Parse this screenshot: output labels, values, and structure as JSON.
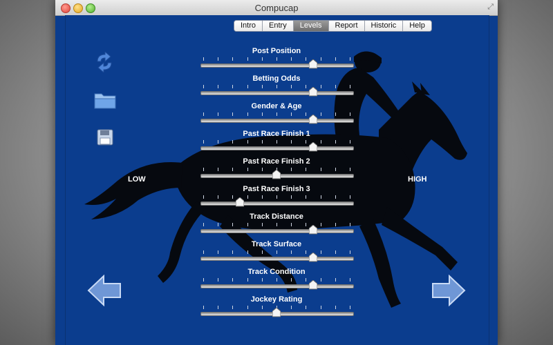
{
  "window": {
    "title": "Compucap"
  },
  "tabs": [
    {
      "label": "Intro",
      "active": false
    },
    {
      "label": "Entry",
      "active": false
    },
    {
      "label": "Levels",
      "active": true
    },
    {
      "label": "Report",
      "active": false
    },
    {
      "label": "Historic",
      "active": false
    },
    {
      "label": "Help",
      "active": false
    }
  ],
  "scale": {
    "low_label": "LOW",
    "high_label": "HIGH"
  },
  "sliders": [
    {
      "label": "Post Position",
      "value": 0.74
    },
    {
      "label": "Betting Odds",
      "value": 0.74
    },
    {
      "label": "Gender & Age",
      "value": 0.74
    },
    {
      "label": "Past Race Finish 1",
      "value": 0.74
    },
    {
      "label": "Past Race Finish 2",
      "value": 0.5
    },
    {
      "label": "Past Race Finish 3",
      "value": 0.26
    },
    {
      "label": "Track Distance",
      "value": 0.74
    },
    {
      "label": "Track Surface",
      "value": 0.74
    },
    {
      "label": "Track Condition",
      "value": 0.74
    },
    {
      "label": "Jockey Rating",
      "value": 0.5
    }
  ],
  "icons": {
    "refresh": "refresh-icon",
    "folder": "folder-icon",
    "save": "save-icon",
    "back": "arrow-left-icon",
    "forward": "arrow-right-icon"
  },
  "colors": {
    "background": "#0b3d8e",
    "silhouette": "#06090f",
    "accent_icon": "#4f86d9"
  }
}
